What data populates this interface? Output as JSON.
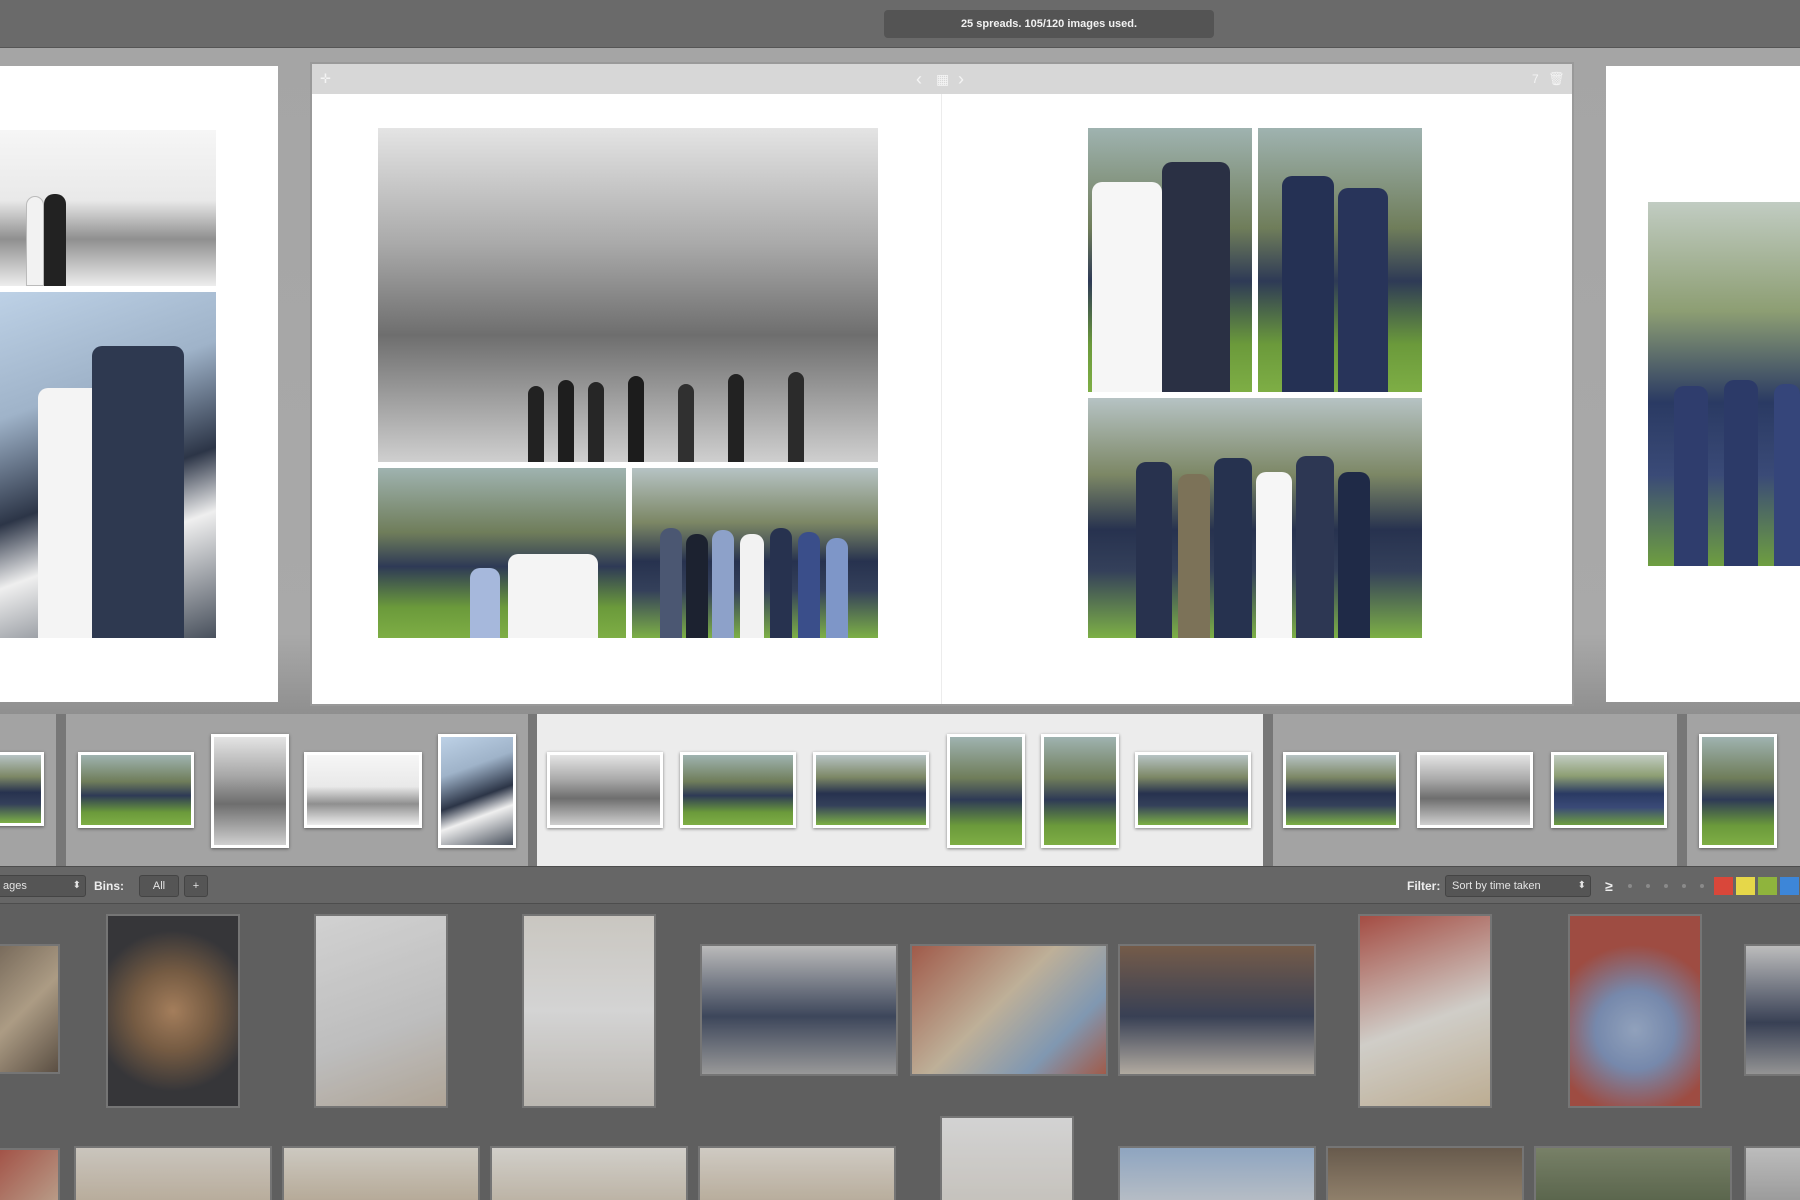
{
  "topbar": {
    "status": "25 spreads. 105/120 images used."
  },
  "spread": {
    "page_count": "7",
    "icons": {
      "move": "move-icon",
      "prev": "chevron-left-icon",
      "grid": "grid-icon",
      "next": "chevron-right-icon",
      "trash": "trash-icon"
    }
  },
  "filter_bar": {
    "source_value": "ages",
    "bins_label": "Bins:",
    "bins_value": "All",
    "add_bin_label": "+",
    "filter_label": "Filter:",
    "sort_value": "Sort by time taken",
    "rating_symbol": "≥",
    "color_labels": [
      "#d9473a",
      "#e6d749",
      "#8fb43d",
      "#3d86d8"
    ]
  },
  "colors": {
    "active_group": "#ececec",
    "inactive_group": "#a3a3a3",
    "pool_background": "#5f5f5f"
  }
}
